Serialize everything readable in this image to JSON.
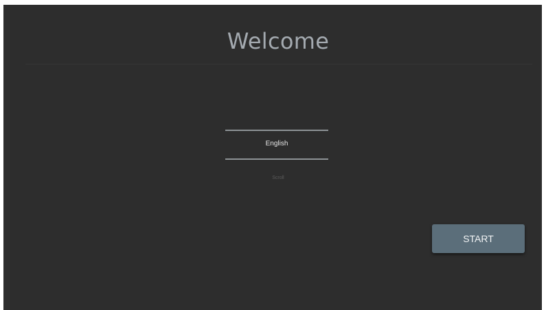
{
  "welcome": {
    "title": "Welcome"
  },
  "language_picker": {
    "selected": "English",
    "hint": "Scroll"
  },
  "actions": {
    "start_label": "START"
  },
  "colors": {
    "background": "#2d2d2d",
    "button": "#5b6e7a",
    "title_text": "#a4aab0"
  }
}
